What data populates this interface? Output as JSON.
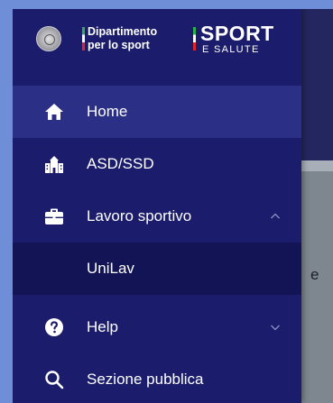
{
  "header": {
    "dept_line1": "Dipartimento",
    "dept_line2": "per lo sport",
    "brand_main": "SPORT",
    "brand_sub": "E SALUTE",
    "emblem_icon": "italian-republic-emblem"
  },
  "menu": {
    "items": [
      {
        "label": "Home",
        "icon": "home-icon",
        "state": "active"
      },
      {
        "label": "ASD/SSD",
        "icon": "buildings-icon",
        "state": "normal"
      },
      {
        "label": "Lavoro sportivo",
        "icon": "briefcase-icon",
        "state": "expanded"
      },
      {
        "label": "UniLav",
        "icon": "",
        "state": "submenu"
      },
      {
        "label": "Help",
        "icon": "help-circle-icon",
        "state": "collapsed"
      },
      {
        "label": "Sezione pubblica",
        "icon": "search-icon",
        "state": "normal"
      }
    ]
  },
  "backdrop": {
    "peek_text": "e"
  },
  "colors": {
    "drawer_bg": "#1b1c6b",
    "active_bg": "#2b2f86",
    "submenu_bg": "#131456",
    "page_bg": "#6f8ed8",
    "chevron": "#8f92c4"
  }
}
